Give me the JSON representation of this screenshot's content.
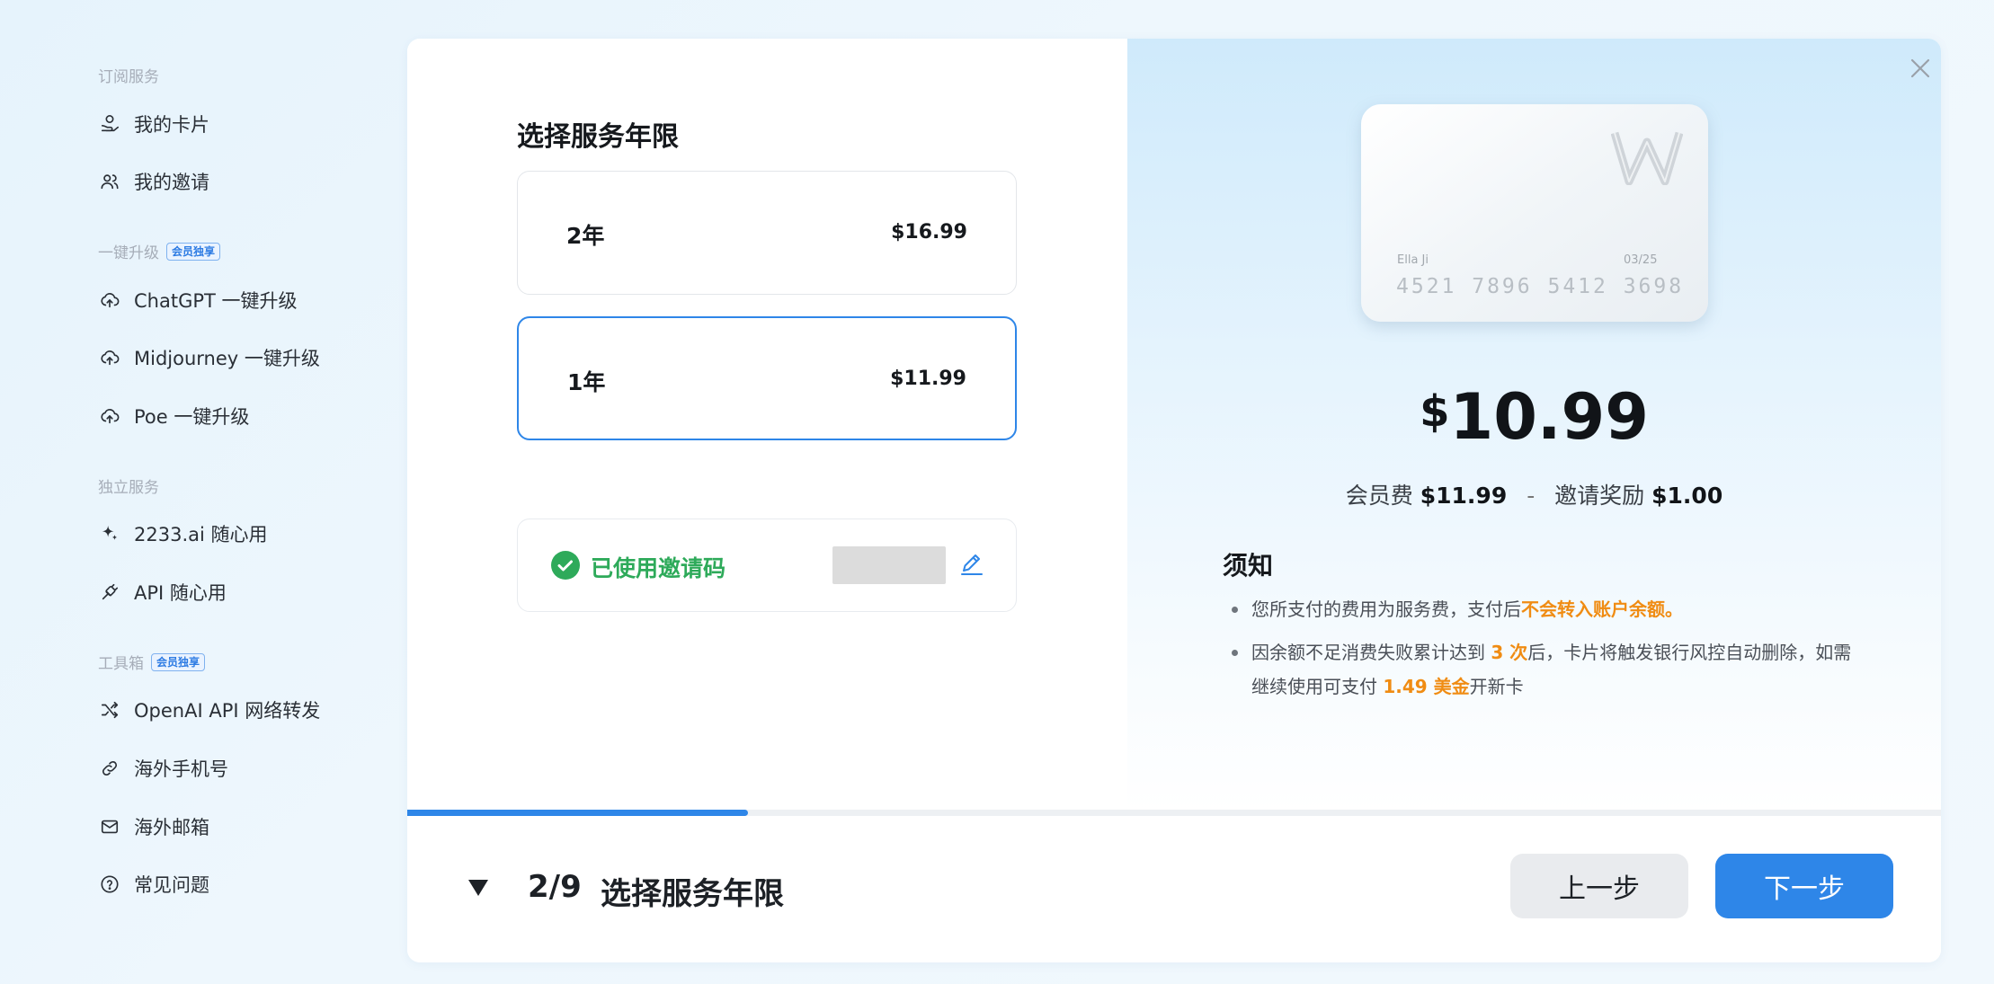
{
  "sidebar": {
    "section_subscription": "订阅服务",
    "my_card": "我的卡片",
    "my_invites": "我的邀请",
    "section_upgrade": "一键升级",
    "badge_upgrade": "会员独享",
    "chatgpt_upgrade": "ChatGPT 一键升级",
    "midjourney_upgrade": "Midjourney 一键升级",
    "poe_upgrade": "Poe 一键升级",
    "section_standalone": "独立服务",
    "ai_2233": "2233.ai 随心用",
    "api_service": "API 随心用",
    "section_toolbox": "工具箱",
    "badge_toolbox": "会员独享",
    "openai_proxy": "OpenAI API 网络转发",
    "overseas_phone": "海外手机号",
    "overseas_email": "海外邮箱",
    "faq": "常见问题"
  },
  "main": {
    "title": "选择服务年限",
    "options": [
      {
        "years": "2年",
        "price": "$16.99",
        "selected": false
      },
      {
        "years": "1年",
        "price": "$11.99",
        "selected": true
      }
    ],
    "invite_label": "已使用邀请码"
  },
  "card": {
    "holder": "Ella Ji",
    "expiry": "03/25",
    "number": "4521 7896 5412 3698"
  },
  "summary": {
    "currency": "$",
    "amount": "10.99",
    "fee_label": "会员费",
    "fee_value": "$11.99",
    "separator": "-",
    "reward_label": "邀请奖励",
    "reward_value": "$1.00"
  },
  "notice": {
    "title": "须知",
    "item1_a": "您所支付的费用为服务费，支付后",
    "item1_hl": "不会转入账户余额。",
    "item2_a": "因余额不足消费失败累计达到 ",
    "item2_hl1": "3 次",
    "item2_b": "后，卡片将触发银行风控自动删除，如需继续使用可支付 ",
    "item2_hl2": "1.49 美金",
    "item2_c": "开新卡"
  },
  "progress": {
    "current": 2,
    "total": 9,
    "fraction": 0.222
  },
  "footer": {
    "step": "2/9",
    "step_title": "选择服务年限",
    "prev_label": "上一步",
    "next_label": "下一步"
  },
  "colors": {
    "accent": "#2e86e8",
    "success": "#2eaa5a",
    "highlight": "#f08c13"
  },
  "icons": [
    "coins-icon",
    "users-icon",
    "cloud-upload-icon",
    "sparkle-icon",
    "plug-icon",
    "shuffle-icon",
    "link-icon",
    "mail-icon",
    "help-circle-icon",
    "check-circle-icon",
    "edit-icon",
    "close-icon",
    "caret-down-icon"
  ]
}
